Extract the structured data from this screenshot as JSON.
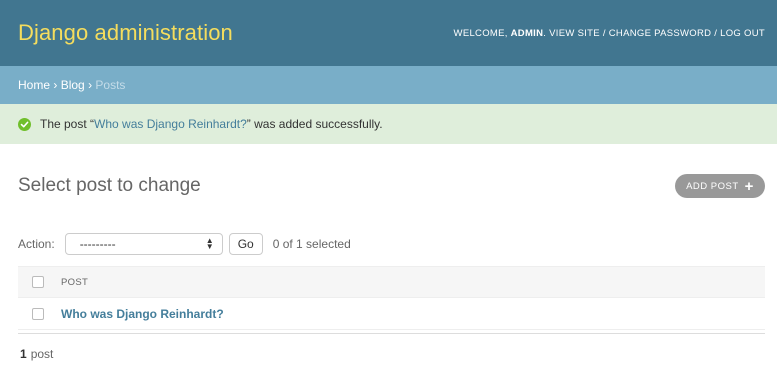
{
  "header": {
    "branding": "Django administration",
    "user_tools": {
      "welcome": "Welcome,",
      "username": "admin",
      "view_site": "View site",
      "separator": "/",
      "change_password": "Change password",
      "log_out": "Log out"
    }
  },
  "breadcrumbs": {
    "home": "Home",
    "app": "Blog",
    "current": "Posts",
    "separator": "›"
  },
  "message": {
    "prefix": "The post “",
    "object_link": "Who was Django Reinhardt?",
    "suffix": "” was added successfully.",
    "icon": "check-circle-icon"
  },
  "content": {
    "title": "Select post to change",
    "add_button_label": "Add post",
    "add_icon": "plus"
  },
  "actions": {
    "label": "Action:",
    "selected_option": "---------",
    "go_label": "Go",
    "selection_count": "0 of 1 selected"
  },
  "table": {
    "column_header": "Post",
    "rows": [
      {
        "title": "Who was Django Reinhardt?"
      }
    ]
  },
  "paginator": {
    "count": "1",
    "label": "post"
  },
  "colors": {
    "header_bg": "#417690",
    "branding": "#f5dd5d",
    "breadcrumbs_bg": "#79aec8",
    "success_bg": "#dfeedb",
    "success_icon": "#70bf2b",
    "link": "#447e9b"
  }
}
